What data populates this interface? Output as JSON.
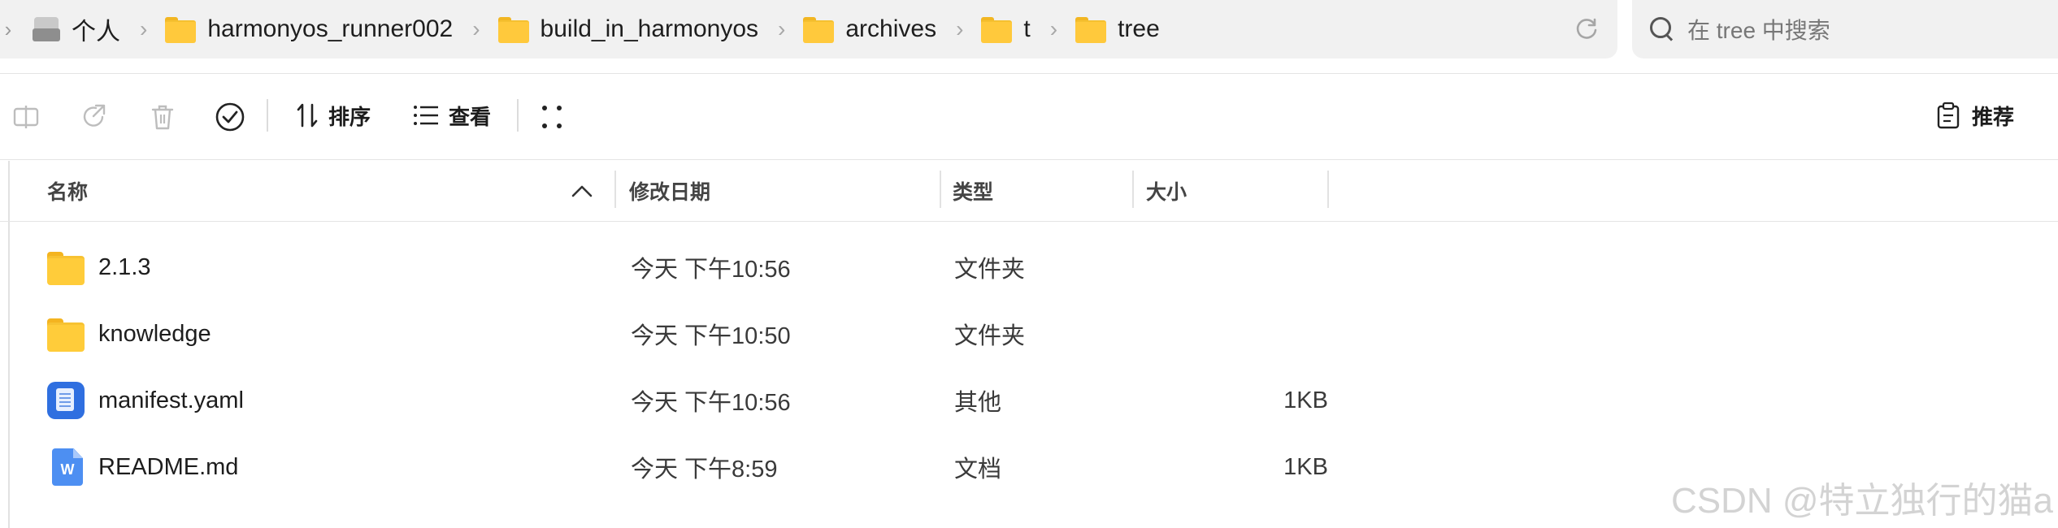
{
  "breadcrumb": {
    "items": [
      {
        "label": "个人",
        "icon": "drive-icon"
      },
      {
        "label": "harmonyos_runner002",
        "icon": "folder-icon"
      },
      {
        "label": "build_in_harmonyos",
        "icon": "folder-icon"
      },
      {
        "label": "archives",
        "icon": "folder-icon"
      },
      {
        "label": "t",
        "icon": "folder-icon"
      },
      {
        "label": "tree",
        "icon": "folder-icon"
      }
    ]
  },
  "search": {
    "placeholder": "在 tree 中搜索"
  },
  "toolbar": {
    "sort_label": "排序",
    "view_label": "查看",
    "recommend_label": "推荐"
  },
  "columns": {
    "name": "名称",
    "modified": "修改日期",
    "type": "类型",
    "size": "大小"
  },
  "files": [
    {
      "name": "2.1.3",
      "modified": "今天 下午10:56",
      "type": "文件夹",
      "size": "",
      "icon": "folder-icon"
    },
    {
      "name": "knowledge",
      "modified": "今天 下午10:50",
      "type": "文件夹",
      "size": "",
      "icon": "folder-icon"
    },
    {
      "name": "manifest.yaml",
      "modified": "今天 下午10:56",
      "type": "其他",
      "size": "1KB",
      "icon": "yaml-file-icon"
    },
    {
      "name": "README.md",
      "modified": "今天 下午8:59",
      "type": "文档",
      "size": "1KB",
      "icon": "word-document-icon"
    }
  ],
  "watermark": "CSDN @特立独行的猫a",
  "colors": {
    "folder": "#ffcc3a",
    "yaml_icon": "#2f6fe0",
    "doc_icon": "#4d8ff2",
    "bar_bg": "#f1f1f1"
  }
}
